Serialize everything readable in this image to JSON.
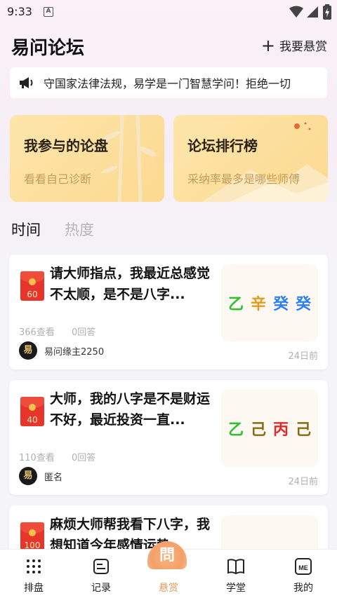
{
  "status_bar": {
    "time": "9:33",
    "a_badge": "A"
  },
  "header": {
    "title": "易问论坛",
    "reward_label": "我要悬赏"
  },
  "notice": {
    "text": "守国家法律法规，易学是一门智慧学问！拒绝一切"
  },
  "cards": [
    {
      "title": "我参与的论盘",
      "subtitle": "看看自己诊断"
    },
    {
      "title": "论坛排行榜",
      "subtitle": "采纳率最多是哪些师傅"
    }
  ],
  "tabs": [
    {
      "label": "时间",
      "active": true
    },
    {
      "label": "热度",
      "active": false
    }
  ],
  "posts": [
    {
      "reward": "60",
      "title": "请大师指点，我最近总感觉不太顺，是不是八字...",
      "views": "366查看",
      "replies": "0回答",
      "user": "易问缘主2250",
      "date": "24日前",
      "bazi": [
        {
          "char": "乙",
          "color": "#2fbf2f"
        },
        {
          "char": "辛",
          "color": "#e79a1a"
        },
        {
          "char": "癸",
          "color": "#2e7ff0"
        },
        {
          "char": "癸",
          "color": "#2e7ff0"
        }
      ]
    },
    {
      "reward": "40",
      "title": "大师，我的八字是不是财运不好，最近投资一直...",
      "views": "110查看",
      "replies": "0回答",
      "user": "匿名",
      "date": "24日前",
      "bazi": [
        {
          "char": "乙",
          "color": "#2fbf2f"
        },
        {
          "char": "己",
          "color": "#8a6a12"
        },
        {
          "char": "丙",
          "color": "#e02a2a"
        },
        {
          "char": "己",
          "color": "#8a6a12"
        }
      ]
    },
    {
      "reward": "100",
      "title": "麻烦大师帮我看下八字，我想知道今年感情运势",
      "views": "",
      "replies": "",
      "user": "",
      "date": "",
      "bazi": []
    }
  ],
  "bottom_nav": [
    {
      "label": "排盘",
      "icon": "grid-icon"
    },
    {
      "label": "记录",
      "icon": "record-icon"
    },
    {
      "label": "悬赏",
      "icon": "reward-icon",
      "badge": "問",
      "active": true
    },
    {
      "label": "学堂",
      "icon": "book-icon"
    },
    {
      "label": "我的",
      "icon": "me-icon"
    }
  ],
  "colors": {
    "accent": "#e49a5a",
    "card_bg": "#fcd98f",
    "envelope": "#e8352b"
  }
}
